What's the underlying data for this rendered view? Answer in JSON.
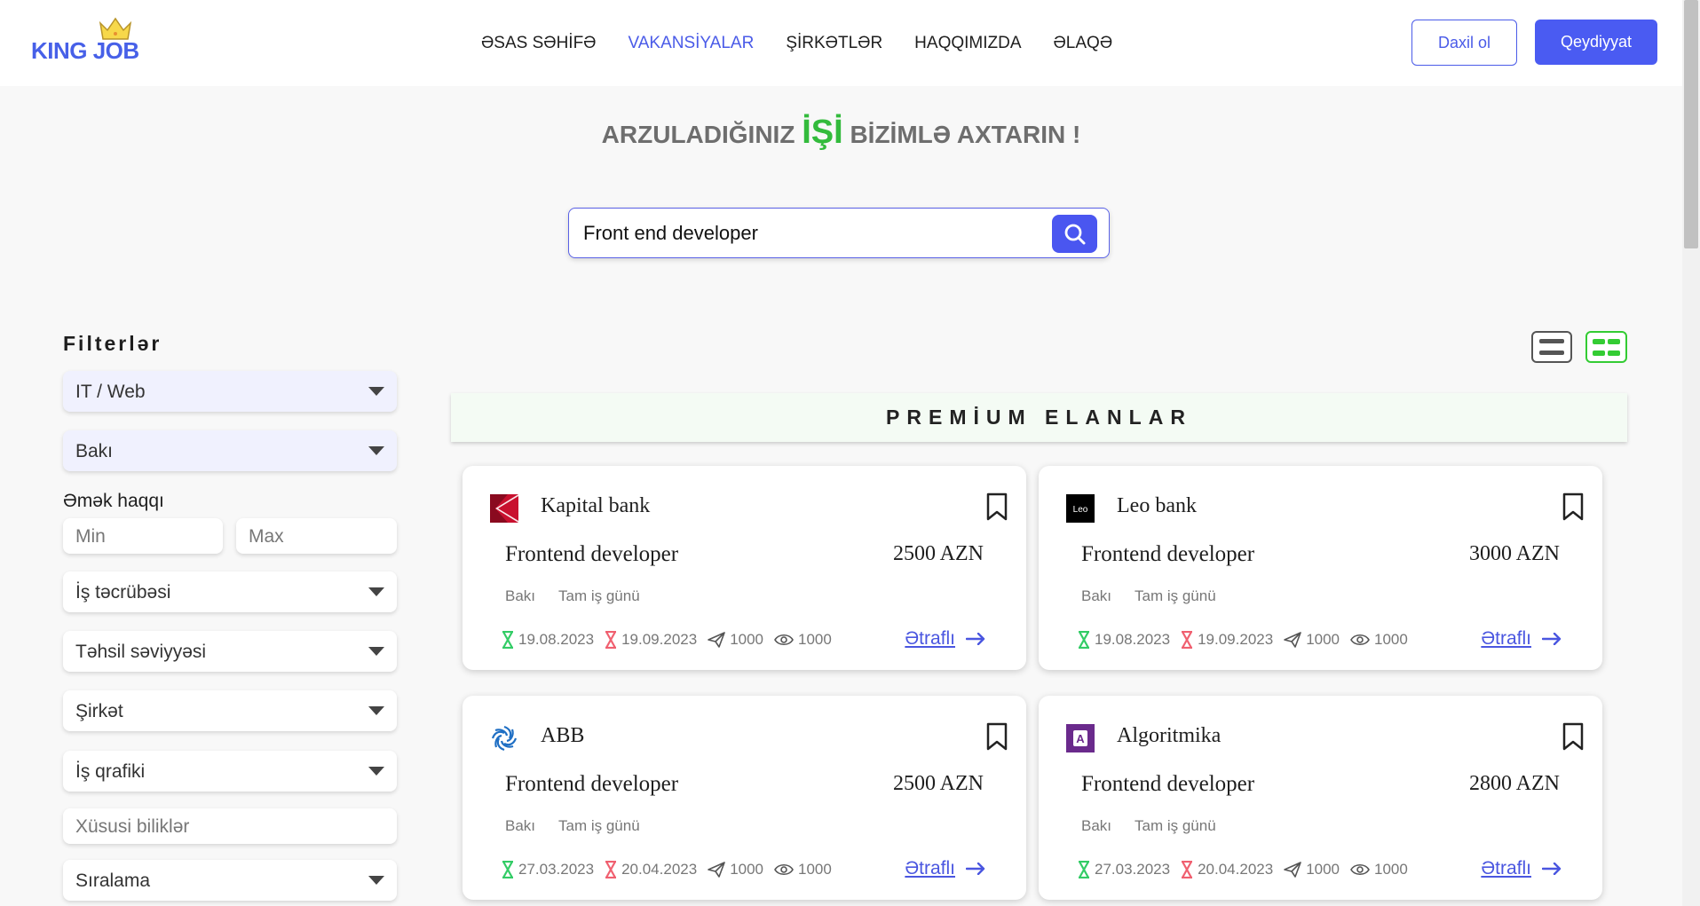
{
  "header": {
    "logo_text": "KING JOB",
    "nav": [
      "ƏSAS SƏHİFƏ",
      "VAKANSİYALAR",
      "ŞİRKƏTLƏR",
      "HAQQIMIZDA",
      "ƏLAQƏ"
    ],
    "active_nav": "VAKANSİYALAR",
    "login_label": "Daxil ol",
    "register_label": "Qeydiyyat"
  },
  "hero": {
    "before": "ARZULADIĞINIZ ",
    "highlight": "İŞİ",
    "after": " BİZİMLƏ AXTARIN !"
  },
  "search": {
    "value": "Front end developer"
  },
  "filters": {
    "title": "Filterlər",
    "category": "IT / Web",
    "city": "Bakı",
    "salary_label": "Əmək haqqı",
    "salary_min_placeholder": "Min",
    "salary_max_placeholder": "Max",
    "experience": "İş təcrübəsi",
    "education": "Təhsil səviyyəsi",
    "company": "Şirkət",
    "schedule": "İş qrafiki",
    "skills_placeholder": "Xüsusi biliklər",
    "sort": "Sıralama"
  },
  "premium_title": "PREMİUM ELANLAR",
  "colors": {
    "accent": "#4a5bf2",
    "green": "#33bb3c",
    "start_icon": "#33cc66",
    "end_icon": "#f06070"
  },
  "jobs": [
    {
      "company": "Kapital bank",
      "logo": "kapital-bank-logo",
      "title": "Frontend developer",
      "salary": "2500 AZN",
      "location": "Bakı",
      "type": "Tam iş günü",
      "start": "19.08.2023",
      "end": "19.09.2023",
      "applications": "1000",
      "views": "1000",
      "more": "Ətraflı"
    },
    {
      "company": "Leo bank",
      "logo": "leo-bank-logo",
      "logo_text": "Leo",
      "title": "Frontend developer",
      "salary": "3000 AZN",
      "location": "Bakı",
      "type": "Tam iş günü",
      "start": "19.08.2023",
      "end": "19.09.2023",
      "applications": "1000",
      "views": "1000",
      "more": "Ətraflı"
    },
    {
      "company": "ABB",
      "logo": "abb-logo",
      "title": "Frontend developer",
      "salary": "2500 AZN",
      "location": "Bakı",
      "type": "Tam iş günü",
      "start": "27.03.2023",
      "end": "20.04.2023",
      "applications": "1000",
      "views": "1000",
      "more": "Ətraflı"
    },
    {
      "company": "Algoritmika",
      "logo": "algoritmika-logo",
      "logo_text": "A",
      "title": "Frontend developer",
      "salary": "2800 AZN",
      "location": "Bakı",
      "type": "Tam iş günü",
      "start": "27.03.2023",
      "end": "20.04.2023",
      "applications": "1000",
      "views": "1000",
      "more": "Ətraflı"
    }
  ]
}
